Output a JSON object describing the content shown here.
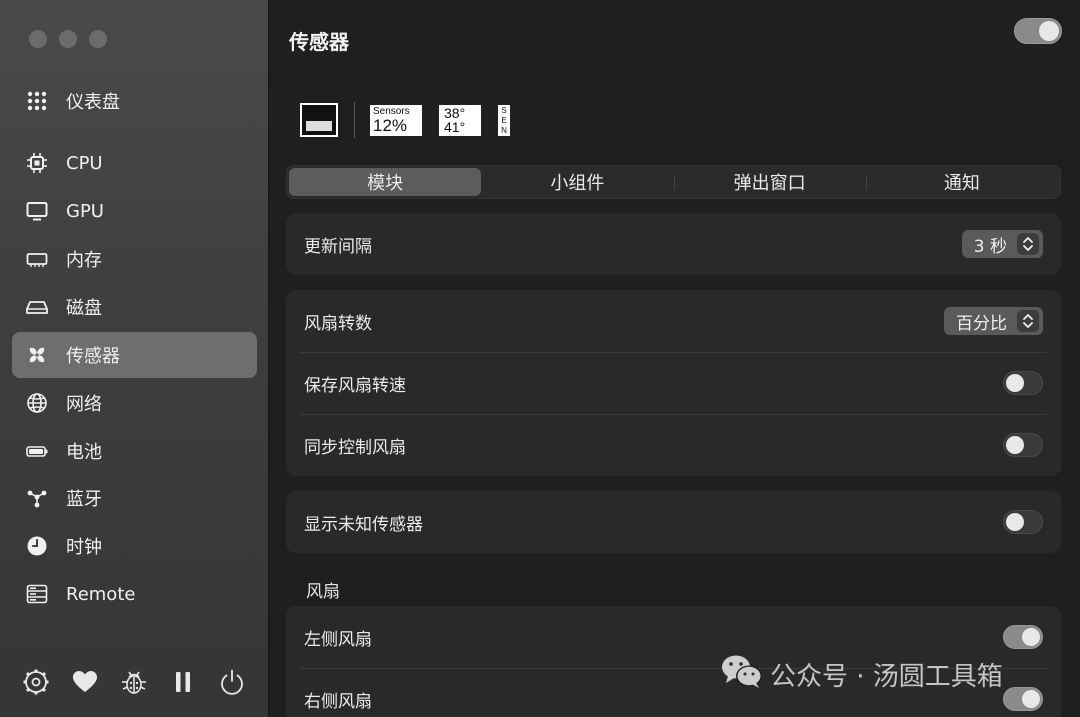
{
  "window": {
    "traffic_lights": [
      "close",
      "minimize",
      "zoom"
    ]
  },
  "sidebar": {
    "items": [
      {
        "label": "仪表盘",
        "icon": "grid-icon",
        "active": false
      },
      {
        "label": "CPU",
        "icon": "cpu-icon",
        "active": false
      },
      {
        "label": "GPU",
        "icon": "monitor-icon",
        "active": false
      },
      {
        "label": "内存",
        "icon": "memory-icon",
        "active": false
      },
      {
        "label": "磁盘",
        "icon": "disk-icon",
        "active": false
      },
      {
        "label": "传感器",
        "icon": "fan-icon",
        "active": true
      },
      {
        "label": "网络",
        "icon": "globe-icon",
        "active": false
      },
      {
        "label": "电池",
        "icon": "battery-icon",
        "active": false
      },
      {
        "label": "蓝牙",
        "icon": "bluetooth-icon",
        "active": false
      },
      {
        "label": "时钟",
        "icon": "clock-icon",
        "active": false
      },
      {
        "label": "Remote",
        "icon": "server-icon",
        "active": false
      }
    ],
    "bottom_icons": [
      "settings-icon",
      "heart-icon",
      "bug-icon",
      "pause-icon",
      "power-icon"
    ]
  },
  "main": {
    "title": "传感器",
    "module_enabled": true,
    "widgets": {
      "sensors_label": "Sensors",
      "sensors_value": "12%",
      "temp_1": "38°",
      "temp_2": "41°",
      "sen_vertical": "SEN"
    },
    "tabs": [
      {
        "label": "模块",
        "active": true
      },
      {
        "label": "小组件",
        "active": false
      },
      {
        "label": "弹出窗口",
        "active": false
      },
      {
        "label": "通知",
        "active": false
      }
    ],
    "update_interval": {
      "label": "更新间隔",
      "value": "3 秒"
    },
    "fan_speed": {
      "label": "风扇转数",
      "value": "百分比"
    },
    "save_fan_speed": {
      "label": "保存风扇转速",
      "on": false
    },
    "sync_fan_control": {
      "label": "同步控制风扇",
      "on": false
    },
    "show_unknown_sensors": {
      "label": "显示未知传感器",
      "on": false
    },
    "fans_section": {
      "title": "风扇",
      "left_fan": {
        "label": "左侧风扇",
        "on": true
      },
      "right_fan": {
        "label": "右侧风扇",
        "on": true
      }
    }
  },
  "watermark": {
    "text": "公众号 · 汤圆工具箱"
  }
}
